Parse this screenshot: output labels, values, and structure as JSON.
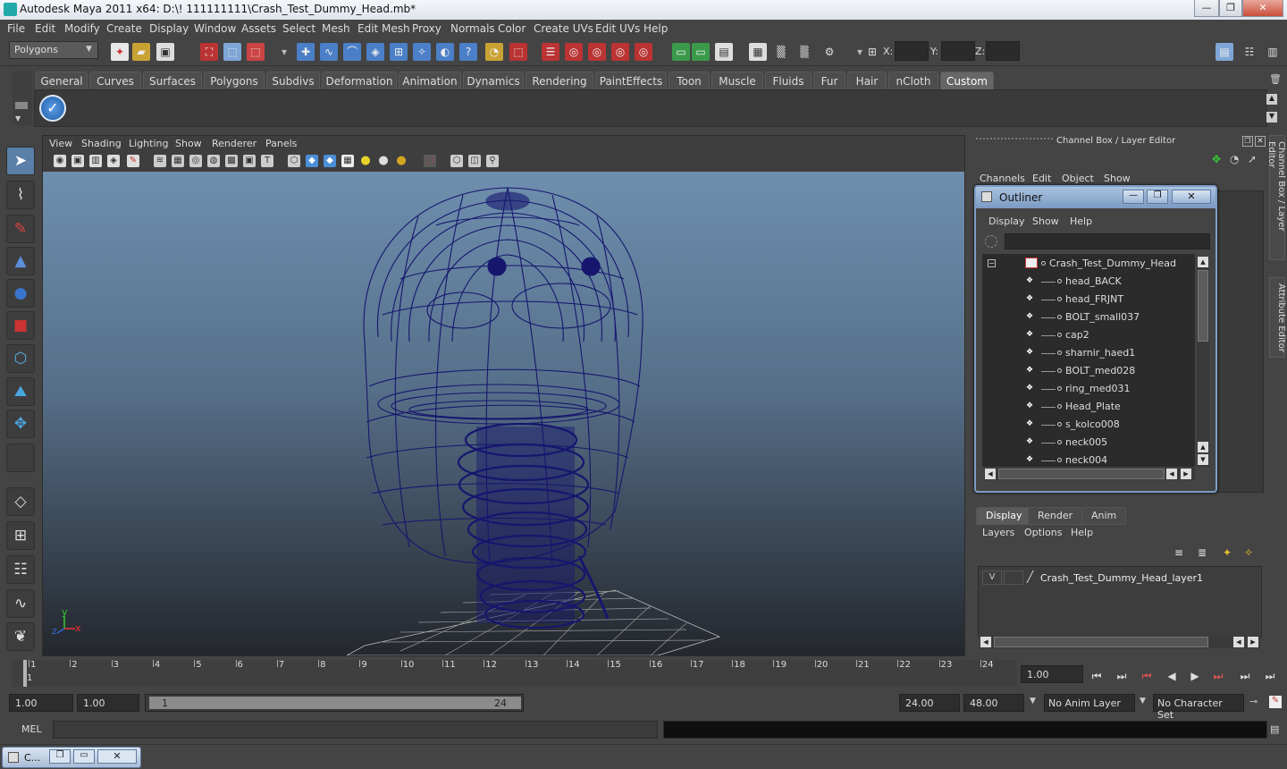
{
  "window": {
    "title": "Autodesk Maya 2011 x64: D:\\! 111111111\\Crash_Test_Dummy_Head.mb*"
  },
  "menubar": [
    "File",
    "Edit",
    "Modify",
    "Create",
    "Display",
    "Window",
    "Assets",
    "Select",
    "Mesh",
    "Edit Mesh",
    "Proxy",
    "Normals",
    "Color",
    "Create UVs",
    "Edit UVs",
    "Help"
  ],
  "status": {
    "mode": "Polygons",
    "x_label": "X:",
    "y_label": "Y:",
    "z_label": "Z:"
  },
  "shelf_tabs": [
    "General",
    "Curves",
    "Surfaces",
    "Polygons",
    "Subdivs",
    "Deformation",
    "Animation",
    "Dynamics",
    "Rendering",
    "PaintEffects",
    "Toon",
    "Muscle",
    "Fluids",
    "Fur",
    "Hair",
    "nCloth",
    "Custom"
  ],
  "shelf_active": "Custom",
  "viewport": {
    "menu": [
      "View",
      "Shading",
      "Lighting",
      "Show",
      "Renderer",
      "Panels"
    ],
    "axis_y": "y",
    "axis_x": "x",
    "axis_z": "z"
  },
  "channel_box": {
    "title": "Channel Box / Layer Editor",
    "menu": [
      "Channels",
      "Edit",
      "Object",
      "Show"
    ],
    "side_tabs": [
      "Channel Box / Layer Editor",
      "Attribute Editor"
    ]
  },
  "outliner": {
    "title": "Outliner",
    "menu": [
      "Display",
      "Show",
      "Help"
    ],
    "root": "Crash_Test_Dummy_Head",
    "items": [
      "head_BACK",
      "head_FRJNT",
      "BOLT_small037",
      "cap2",
      "sharnir_haed1",
      "BOLT_med028",
      "ring_med031",
      "Head_Plate",
      "s_kolco008",
      "neck005",
      "neck004"
    ]
  },
  "layer_editor": {
    "tabs": [
      "Display",
      "Render",
      "Anim"
    ],
    "active_tab": "Display",
    "menu": [
      "Layers",
      "Options",
      "Help"
    ],
    "layer": {
      "visible": "V",
      "name": "Crash_Test_Dummy_Head_layer1"
    }
  },
  "timeline": {
    "frames": [
      "1",
      "2",
      "3",
      "4",
      "5",
      "6",
      "7",
      "8",
      "9",
      "10",
      "11",
      "12",
      "13",
      "14",
      "15",
      "16",
      "17",
      "18",
      "19",
      "20",
      "21",
      "22",
      "23",
      "24"
    ],
    "current_frame_marker": "1",
    "current_time": "1.00"
  },
  "range": {
    "start": "1.00",
    "playback_start": "1.00",
    "slider_start": "1",
    "slider_end": "24",
    "playback_end": "24.00",
    "end": "48.00",
    "anim_layer": "No Anim Layer",
    "character_set": "No Character Set"
  },
  "command": {
    "label": "MEL"
  },
  "taskbar": {
    "item": "C..."
  },
  "colors": {
    "wire": "#16166e",
    "panel_bg": "#444444",
    "active_tab": "#666666"
  }
}
